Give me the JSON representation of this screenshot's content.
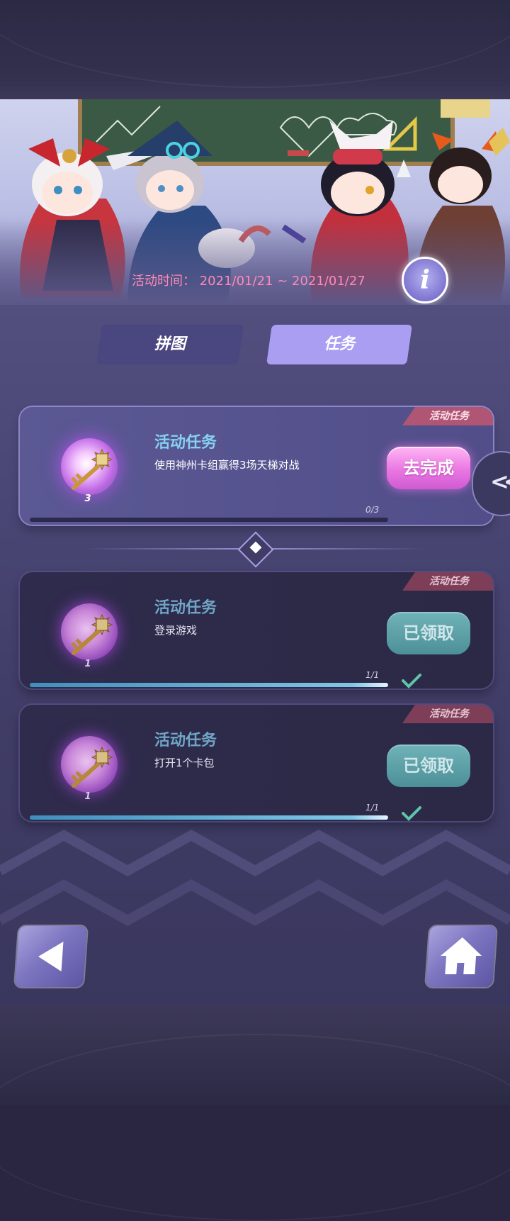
{
  "event": {
    "time_label": "活动时间：",
    "time_range": "2021/01/21 ~ 2021/01/27",
    "info_glyph": "i"
  },
  "tabs": [
    {
      "label": "拼图",
      "active": false
    },
    {
      "label": "任务",
      "active": true
    }
  ],
  "tasks": [
    {
      "tag": "活动任务",
      "title": "活动任务",
      "description": "使用神州卡组赢得3场天梯对战",
      "reward_icon": "key-icon",
      "reward_count": "3",
      "progress_text": "0/3",
      "progress": 0,
      "button_label": "去完成",
      "state": "in-progress"
    },
    {
      "tag": "活动任务",
      "title": "活动任务",
      "description": "登录游戏",
      "reward_icon": "key-icon",
      "reward_count": "1",
      "progress_text": "1/1",
      "progress": 1,
      "button_label": "已领取",
      "state": "claimed"
    },
    {
      "tag": "活动任务",
      "title": "活动任务",
      "description": "打开1个卡包",
      "reward_icon": "key-icon",
      "reward_count": "1",
      "progress_text": "1/1",
      "progress": 1,
      "button_label": "已领取",
      "state": "claimed"
    }
  ],
  "side_tab": {
    "glyph": "<<"
  },
  "nav": {
    "back_icon": "back-arrow-icon",
    "home_icon": "home-icon"
  },
  "colors": {
    "accent_pink": "#ff89b8",
    "title_blue": "#86d0f2",
    "go_button": "#e977e2",
    "claimed_button": "#4d8f98",
    "tab_active": "#aa9ef2"
  }
}
